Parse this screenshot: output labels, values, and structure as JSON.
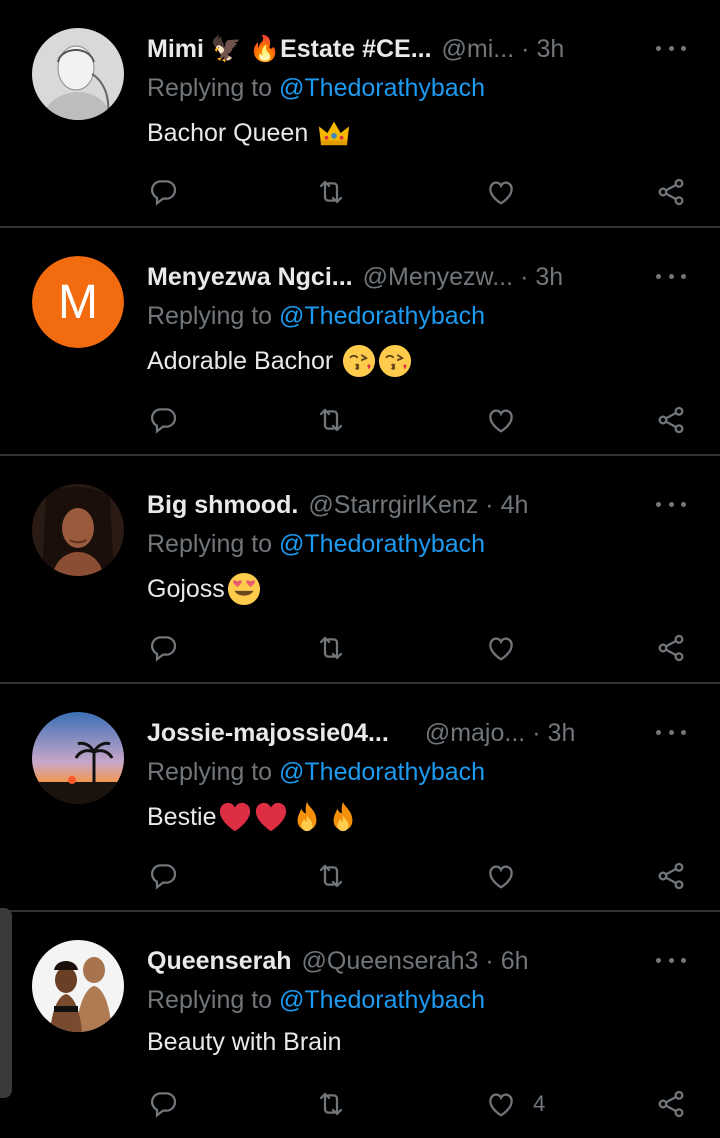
{
  "colors": {
    "background": "#000000",
    "text": "#e7e9ea",
    "muted": "#71767b",
    "mention": "#1d9bf0",
    "divider": "#2f3336"
  },
  "tweets": [
    {
      "name": "Mimi 🦅 🔥Estate #CE...",
      "handle": "@mi...",
      "dot": "·",
      "time": "3h",
      "replying_prefix": "Replying to ",
      "replying_to": "@Thedorathybach",
      "text": "Bachor Queen",
      "emojis": [
        "crown-emoji"
      ],
      "like_count": ""
    },
    {
      "name": "Menyezwa Ngci...",
      "handle": "@Menyezw...",
      "dot": "·",
      "time": "3h",
      "avatar_letter": "M",
      "replying_prefix": "Replying to ",
      "replying_to": "@Thedorathybach",
      "text": "Adorable Bachor",
      "emojis": [
        "kissing-face-emoji",
        "kissing-face-emoji"
      ],
      "like_count": ""
    },
    {
      "name": "Big shmood.",
      "handle": "@StarrgirlKenz",
      "dot": "·",
      "time": "4h",
      "replying_prefix": "Replying to ",
      "replying_to": "@Thedorathybach",
      "text": "Gojoss",
      "emojis": [
        "heart-eyes-emoji"
      ],
      "like_count": ""
    },
    {
      "name": "Jossie-majossie04...",
      "handle": "@majo...",
      "dot": "·",
      "time": "3h",
      "replying_prefix": "Replying to ",
      "replying_to": "@Thedorathybach",
      "text": "Bestie",
      "emojis": [
        "red-heart-emoji",
        "red-heart-emoji",
        "fire-emoji",
        "fire-emoji"
      ],
      "like_count": ""
    },
    {
      "name": "Queenserah",
      "handle": "@Queenserah3",
      "dot": "·",
      "time": "6h",
      "replying_prefix": "Replying to ",
      "replying_to": "@Thedorathybach",
      "text": "Beauty with Brain",
      "emojis": [],
      "like_count": "4"
    }
  ],
  "action_icons": [
    "reply-icon",
    "retweet-icon",
    "like-icon",
    "share-icon"
  ]
}
